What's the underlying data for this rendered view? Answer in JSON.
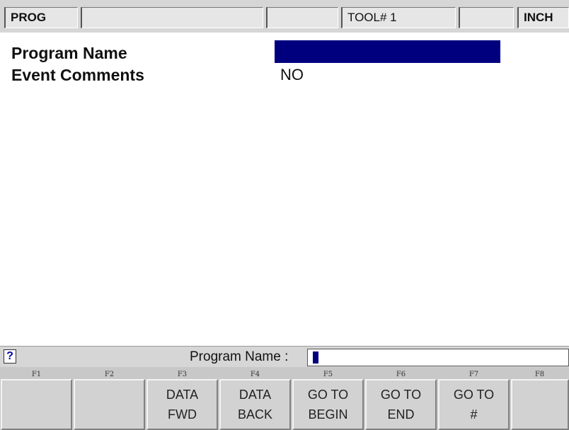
{
  "status_bar": {
    "mode": "PROG",
    "tool": "TOOL# 1",
    "units": "INCH"
  },
  "fields": {
    "program_name_label": "Program Name",
    "event_comments_label": "Event Comments",
    "event_comments_value": "NO"
  },
  "prompt": {
    "help_icon": "?",
    "label": "Program Name :",
    "value": ""
  },
  "function_keys": [
    {
      "key": "F1",
      "line1": "",
      "line2": ""
    },
    {
      "key": "F2",
      "line1": "",
      "line2": ""
    },
    {
      "key": "F3",
      "line1": "DATA",
      "line2": "FWD"
    },
    {
      "key": "F4",
      "line1": "DATA",
      "line2": "BACK"
    },
    {
      "key": "F5",
      "line1": "GO TO",
      "line2": "BEGIN"
    },
    {
      "key": "F6",
      "line1": "GO TO",
      "line2": "END"
    },
    {
      "key": "F7",
      "line1": "GO TO",
      "line2": "#"
    },
    {
      "key": "F8",
      "line1": "",
      "line2": ""
    }
  ],
  "colors": {
    "highlight": "#00007f",
    "panel": "#d6d6d6"
  }
}
